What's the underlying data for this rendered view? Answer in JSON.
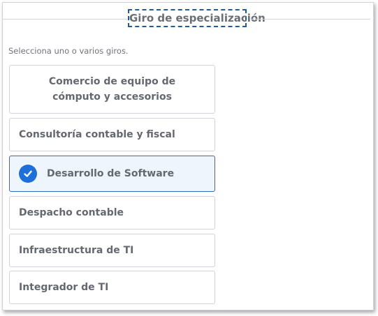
{
  "fieldset": {
    "title": "Giro de especialización",
    "instructions": "Selecciona uno o varios giros."
  },
  "options": [
    {
      "label": "Comercio de equipo de cómputo y accesorios",
      "selected": false
    },
    {
      "label": "Consultoría contable y fiscal",
      "selected": false
    },
    {
      "label": "Desarrollo de Software",
      "selected": true
    },
    {
      "label": "Despacho contable",
      "selected": false
    },
    {
      "label": "Infraestructura de TI",
      "selected": false
    },
    {
      "label": "Integrador de TI",
      "selected": false
    }
  ],
  "colors": {
    "accent": "#1e6fd9",
    "selected_bg": "#eef5fd",
    "focus_outline": "#1e5a9c"
  },
  "icons": {
    "selected_marker": "check-circle-icon"
  }
}
